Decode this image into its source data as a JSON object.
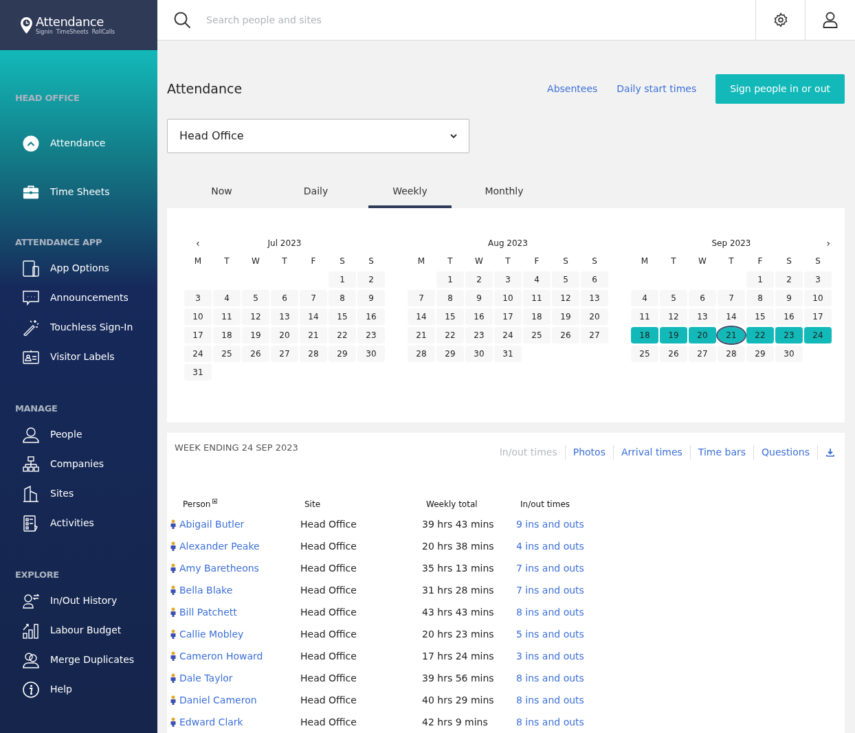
{
  "logo": {
    "title": "Attendance",
    "tagline": [
      "Signin",
      "TimeSheets",
      "RollCalls"
    ]
  },
  "search": {
    "placeholder": "Search people and sites"
  },
  "sidebar": {
    "sections": [
      {
        "heading": "HEAD OFFICE",
        "items": [
          {
            "label": "Attendance",
            "kind": "attendance"
          },
          {
            "label": "Time Sheets",
            "kind": "toolbox"
          }
        ]
      },
      {
        "heading": "ATTENDANCE APP",
        "items": [
          {
            "label": "App Options",
            "kind": "devices"
          },
          {
            "label": "Announcements",
            "kind": "chat"
          },
          {
            "label": "Touchless Sign-In",
            "kind": "wand"
          },
          {
            "label": "Visitor Labels",
            "kind": "badge"
          }
        ]
      },
      {
        "heading": "MANAGE",
        "items": [
          {
            "label": "People",
            "kind": "person"
          },
          {
            "label": "Companies",
            "kind": "org"
          },
          {
            "label": "Sites",
            "kind": "building"
          },
          {
            "label": "Activities",
            "kind": "checklist"
          }
        ]
      },
      {
        "heading": "EXPLORE",
        "items": [
          {
            "label": "In/Out History",
            "kind": "history"
          },
          {
            "label": "Labour Budget",
            "kind": "chart"
          },
          {
            "label": "Merge Duplicates",
            "kind": "merge"
          },
          {
            "label": "Help",
            "kind": "info"
          }
        ]
      }
    ]
  },
  "page": {
    "title": "Attendance",
    "links": [
      "Absentees",
      "Daily start times"
    ],
    "primary_button": "Sign people in or out",
    "site_select": "Head Office"
  },
  "tabs": [
    {
      "label": "Now",
      "selected": false
    },
    {
      "label": "Daily",
      "selected": false
    },
    {
      "label": "Weekly",
      "selected": true
    },
    {
      "label": "Monthly",
      "selected": false
    }
  ],
  "calendar": {
    "previous": "‹",
    "next": "›",
    "months": [
      {
        "title": "Jul 2023",
        "weekdays": [
          "M",
          "T",
          "W",
          "T",
          "F",
          "S",
          "S"
        ],
        "weeks": [
          [
            {
              "day": "1"
            },
            {
              "day": "2"
            }
          ],
          [
            {
              "day": "3"
            },
            {
              "day": "4"
            },
            {
              "day": "5"
            },
            {
              "day": "6"
            },
            {
              "day": "7"
            },
            {
              "day": "8"
            },
            {
              "day": "9"
            }
          ],
          [
            {
              "day": "10"
            },
            {
              "day": "11"
            },
            {
              "day": "12"
            },
            {
              "day": "13"
            },
            {
              "day": "14"
            },
            {
              "day": "15"
            },
            {
              "day": "16"
            }
          ],
          [
            {
              "day": "17"
            },
            {
              "day": "18"
            },
            {
              "day": "19"
            },
            {
              "day": "20"
            },
            {
              "day": "21"
            },
            {
              "day": "22"
            },
            {
              "day": "23"
            }
          ],
          [
            {
              "day": "24"
            },
            {
              "day": "25"
            },
            {
              "day": "26"
            },
            {
              "day": "27"
            },
            {
              "day": "28"
            },
            {
              "day": "29"
            },
            {
              "day": "30"
            }
          ],
          [
            {
              "day": "31"
            }
          ]
        ]
      },
      {
        "title": "Aug 2023",
        "weekdays": [
          "M",
          "T",
          "W",
          "T",
          "F",
          "S",
          "S"
        ],
        "weeks": [
          [
            {
              "day": "1"
            },
            {
              "day": "2"
            },
            {
              "day": "3"
            },
            {
              "day": "4"
            },
            {
              "day": "5"
            },
            {
              "day": "6"
            }
          ],
          [
            {
              "day": "7"
            },
            {
              "day": "8"
            },
            {
              "day": "9"
            },
            {
              "day": "10"
            },
            {
              "day": "11"
            },
            {
              "day": "12"
            },
            {
              "day": "13"
            }
          ],
          [
            {
              "day": "14"
            },
            {
              "day": "15"
            },
            {
              "day": "16"
            },
            {
              "day": "17"
            },
            {
              "day": "18"
            },
            {
              "day": "19"
            },
            {
              "day": "20"
            }
          ],
          [
            {
              "day": "21"
            },
            {
              "day": "22"
            },
            {
              "day": "23"
            },
            {
              "day": "24"
            },
            {
              "day": "25"
            },
            {
              "day": "26"
            },
            {
              "day": "27"
            }
          ],
          [
            {
              "day": "28"
            },
            {
              "day": "29"
            },
            {
              "day": "30"
            },
            {
              "day": "31"
            }
          ]
        ]
      },
      {
        "title": "Sep 2023",
        "weekdays": [
          "M",
          "T",
          "W",
          "T",
          "F",
          "S",
          "S"
        ],
        "weeks": [
          [
            {
              "day": "1"
            },
            {
              "day": "2"
            },
            {
              "day": "3"
            }
          ],
          [
            {
              "day": "4"
            },
            {
              "day": "5"
            },
            {
              "day": "6"
            },
            {
              "day": "7"
            },
            {
              "day": "8"
            },
            {
              "day": "9"
            },
            {
              "day": "10"
            }
          ],
          [
            {
              "day": "11"
            },
            {
              "day": "12"
            },
            {
              "day": "13"
            },
            {
              "day": "14"
            },
            {
              "day": "15"
            },
            {
              "day": "16"
            },
            {
              "day": "17"
            }
          ],
          [
            {
              "day": "18",
              "selected": true
            },
            {
              "day": "19",
              "selected": true
            },
            {
              "day": "20",
              "selected": true
            },
            {
              "day": "21",
              "selected": true,
              "today": true
            },
            {
              "day": "22",
              "selected": true
            },
            {
              "day": "23",
              "selected": true
            },
            {
              "day": "24",
              "selected": true
            }
          ],
          [
            {
              "day": "25"
            },
            {
              "day": "26"
            },
            {
              "day": "27"
            },
            {
              "day": "28"
            },
            {
              "day": "29"
            },
            {
              "day": "30"
            }
          ]
        ]
      }
    ]
  },
  "report": {
    "title": "WEEK ENDING 24 SEP 2023",
    "views": [
      {
        "label": "In/out times",
        "selected": true
      },
      {
        "label": "Photos",
        "selected": false
      },
      {
        "label": "Arrival times",
        "selected": false
      },
      {
        "label": "Time bars",
        "selected": false
      },
      {
        "label": "Questions",
        "selected": false
      }
    ],
    "columns": [
      "Person",
      "Site",
      "Weekly total",
      "In/out times"
    ],
    "rows": [
      {
        "person": "Abigail Butler",
        "site": "Head Office",
        "total": "39 hrs 43 mins",
        "inouts": "9 ins and outs"
      },
      {
        "person": "Alexander Peake",
        "site": "Head Office",
        "total": "20 hrs 38 mins",
        "inouts": "4 ins and outs"
      },
      {
        "person": "Amy Baretheons",
        "site": "Head Office",
        "total": "35 hrs 13 mins",
        "inouts": "7 ins and outs"
      },
      {
        "person": "Bella Blake",
        "site": "Head Office",
        "total": "31 hrs 28 mins",
        "inouts": "7 ins and outs"
      },
      {
        "person": "Bill Patchett",
        "site": "Head Office",
        "total": "43 hrs 43 mins",
        "inouts": "8 ins and outs"
      },
      {
        "person": "Callie Mobley",
        "site": "Head Office",
        "total": "20 hrs 23 mins",
        "inouts": "5 ins and outs"
      },
      {
        "person": "Cameron Howard",
        "site": "Head Office",
        "total": "17 hrs 24 mins",
        "inouts": "3 ins and outs"
      },
      {
        "person": "Dale Taylor",
        "site": "Head Office",
        "total": "39 hrs 56 mins",
        "inouts": "8 ins and outs"
      },
      {
        "person": "Daniel Cameron",
        "site": "Head Office",
        "total": "40 hrs 29 mins",
        "inouts": "8 ins and outs"
      },
      {
        "person": "Edward Clark",
        "site": "Head Office",
        "total": "42 hrs 9 mins",
        "inouts": "8 ins and outs"
      }
    ]
  }
}
